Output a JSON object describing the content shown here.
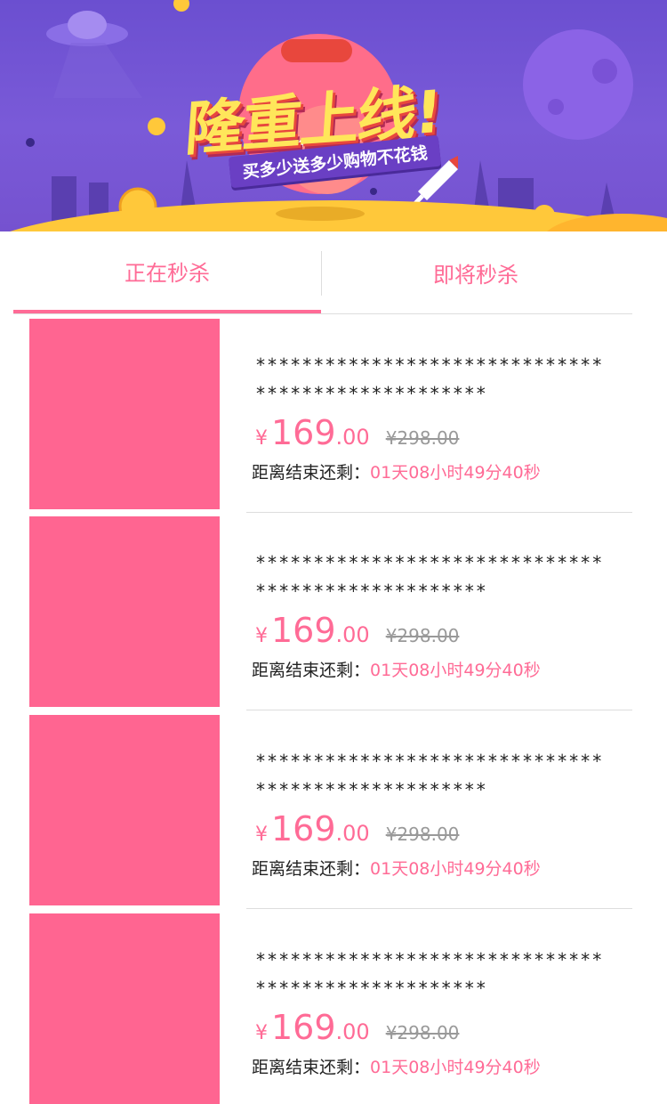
{
  "banner": {
    "title": "隆重上线!",
    "subtitle": "买多少送多少购物不花钱",
    "colors": {
      "bg": "#6b4fd0",
      "title": "#ffe65a",
      "accent": "#e8473d",
      "coin": "#ffc83a"
    }
  },
  "tabs": [
    {
      "label": "正在秒杀",
      "active": true
    },
    {
      "label": "即将秒杀",
      "active": false
    }
  ],
  "items": [
    {
      "desc": "**************************************************",
      "currency": "¥",
      "price_int": "169",
      "price_dec": ".00",
      "original": "¥298.00",
      "countdown_label": "距离结束还剩：",
      "countdown": "01天08小时49分40秒"
    },
    {
      "desc": "**************************************************",
      "currency": "¥",
      "price_int": "169",
      "price_dec": ".00",
      "original": "¥298.00",
      "countdown_label": "距离结束还剩：",
      "countdown": "01天08小时49分40秒"
    },
    {
      "desc": "**************************************************",
      "currency": "¥",
      "price_int": "169",
      "price_dec": ".00",
      "original": "¥298.00",
      "countdown_label": "距离结束还剩：",
      "countdown": "01天08小时49分40秒"
    },
    {
      "desc": "**************************************************",
      "currency": "¥",
      "price_int": "169",
      "price_dec": ".00",
      "original": "¥298.00",
      "countdown_label": "距离结束还剩：",
      "countdown": "01天08小时49分40秒"
    }
  ],
  "colors": {
    "accent": "#ff6b96",
    "thumb": "#ff6591",
    "divider": "#dddddd"
  }
}
